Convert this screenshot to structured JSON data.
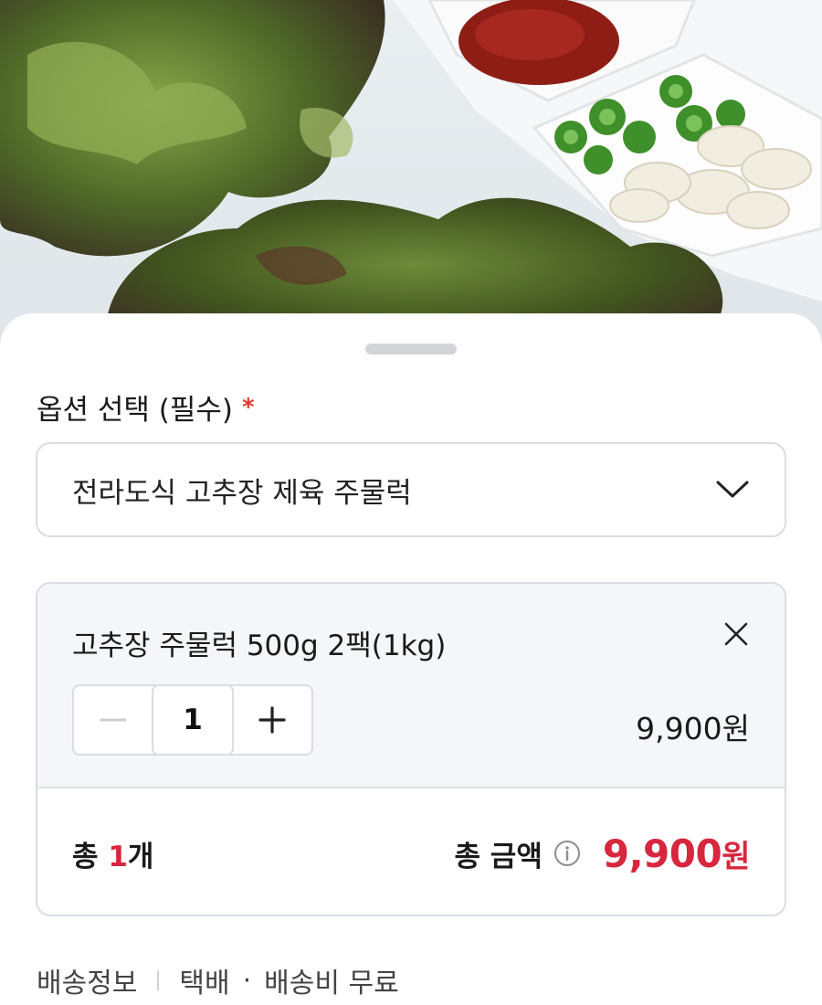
{
  "photo": {
    "description_icon": "product-photo"
  },
  "option_section": {
    "title": "옵션 선택 (필수)",
    "required_mark": "*",
    "selected_value": "전라도식 고추장 제육 주물럭"
  },
  "selected_option": {
    "name": "고추장 주물럭 500g 2팩(1kg)",
    "quantity": "1",
    "price": "9,900원"
  },
  "summary": {
    "total_prefix": "총 ",
    "total_count": "1",
    "total_suffix": "개",
    "total_label": "총 금액",
    "total_price": "9,900",
    "currency": "원"
  },
  "shipping": {
    "label": "배송정보",
    "method": "택배",
    "dot": "·",
    "fee": "배송비 무료"
  },
  "colors": {
    "accent": "#d7263d",
    "required": "#e23b2e",
    "border": "#d9dde2"
  }
}
